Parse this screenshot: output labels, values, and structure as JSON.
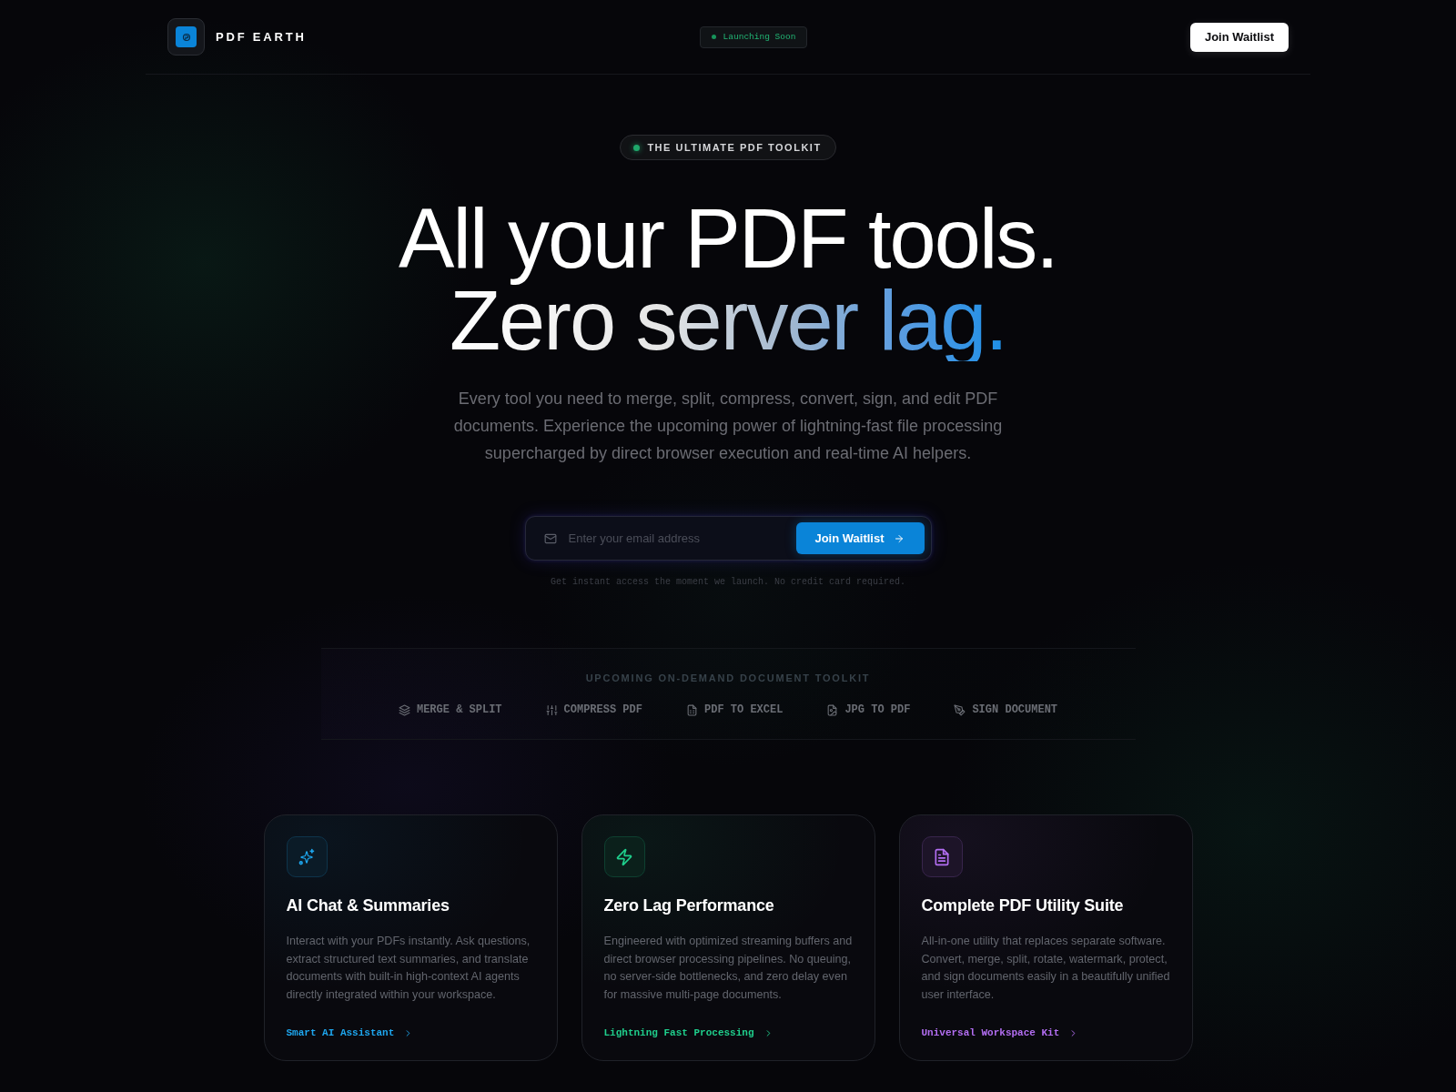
{
  "header": {
    "brand": "PDF EARTH",
    "status_badge": "Launching Soon",
    "cta": "Join Waitlist"
  },
  "hero": {
    "eyebrow": "THE ULTIMATE PDF TOOLKIT",
    "headline": [
      "All your PDF tools.",
      "Zero server lag."
    ],
    "description": "Every tool you need to merge, split, compress, convert, sign, and edit PDF documents. Experience the upcoming power of lightning-fast file processing supercharged by direct browser execution and real-time AI helpers.",
    "email": {
      "placeholder": "Enter your email address"
    },
    "submit": "Join Waitlist",
    "note": "Get instant access the moment we launch. No credit card required."
  },
  "toolkit": {
    "label": "UPCOMING ON-DEMAND DOCUMENT TOOLKIT",
    "tools": [
      "MERGE & SPLIT",
      "COMPRESS PDF",
      "PDF TO EXCEL",
      "JPG TO PDF",
      "SIGN DOCUMENT"
    ]
  },
  "features": [
    {
      "title": "AI Chat & Summaries",
      "description": "Interact with your PDFs instantly. Ask questions, extract structured text summaries, and translate documents with built-in high-context AI agents directly integrated within your workspace.",
      "link": "Smart AI Assistant",
      "color": "#1ea6ee"
    },
    {
      "title": "Zero Lag Performance",
      "description": "Engineered with optimized streaming buffers and direct browser processing pipelines. No queuing, no server-side bottlenecks, and zero delay even for massive multi-page documents.",
      "link": "Lightning Fast Processing",
      "color": "#1fcf8c"
    },
    {
      "title": "Complete PDF Utility Suite",
      "description": "All-in-one utility that replaces separate software. Convert, merge, split, rotate, watermark, protect, and sign documents easily in a beautifully unified user interface.",
      "link": "Universal Workspace Kit",
      "color": "#b36ef2"
    }
  ]
}
